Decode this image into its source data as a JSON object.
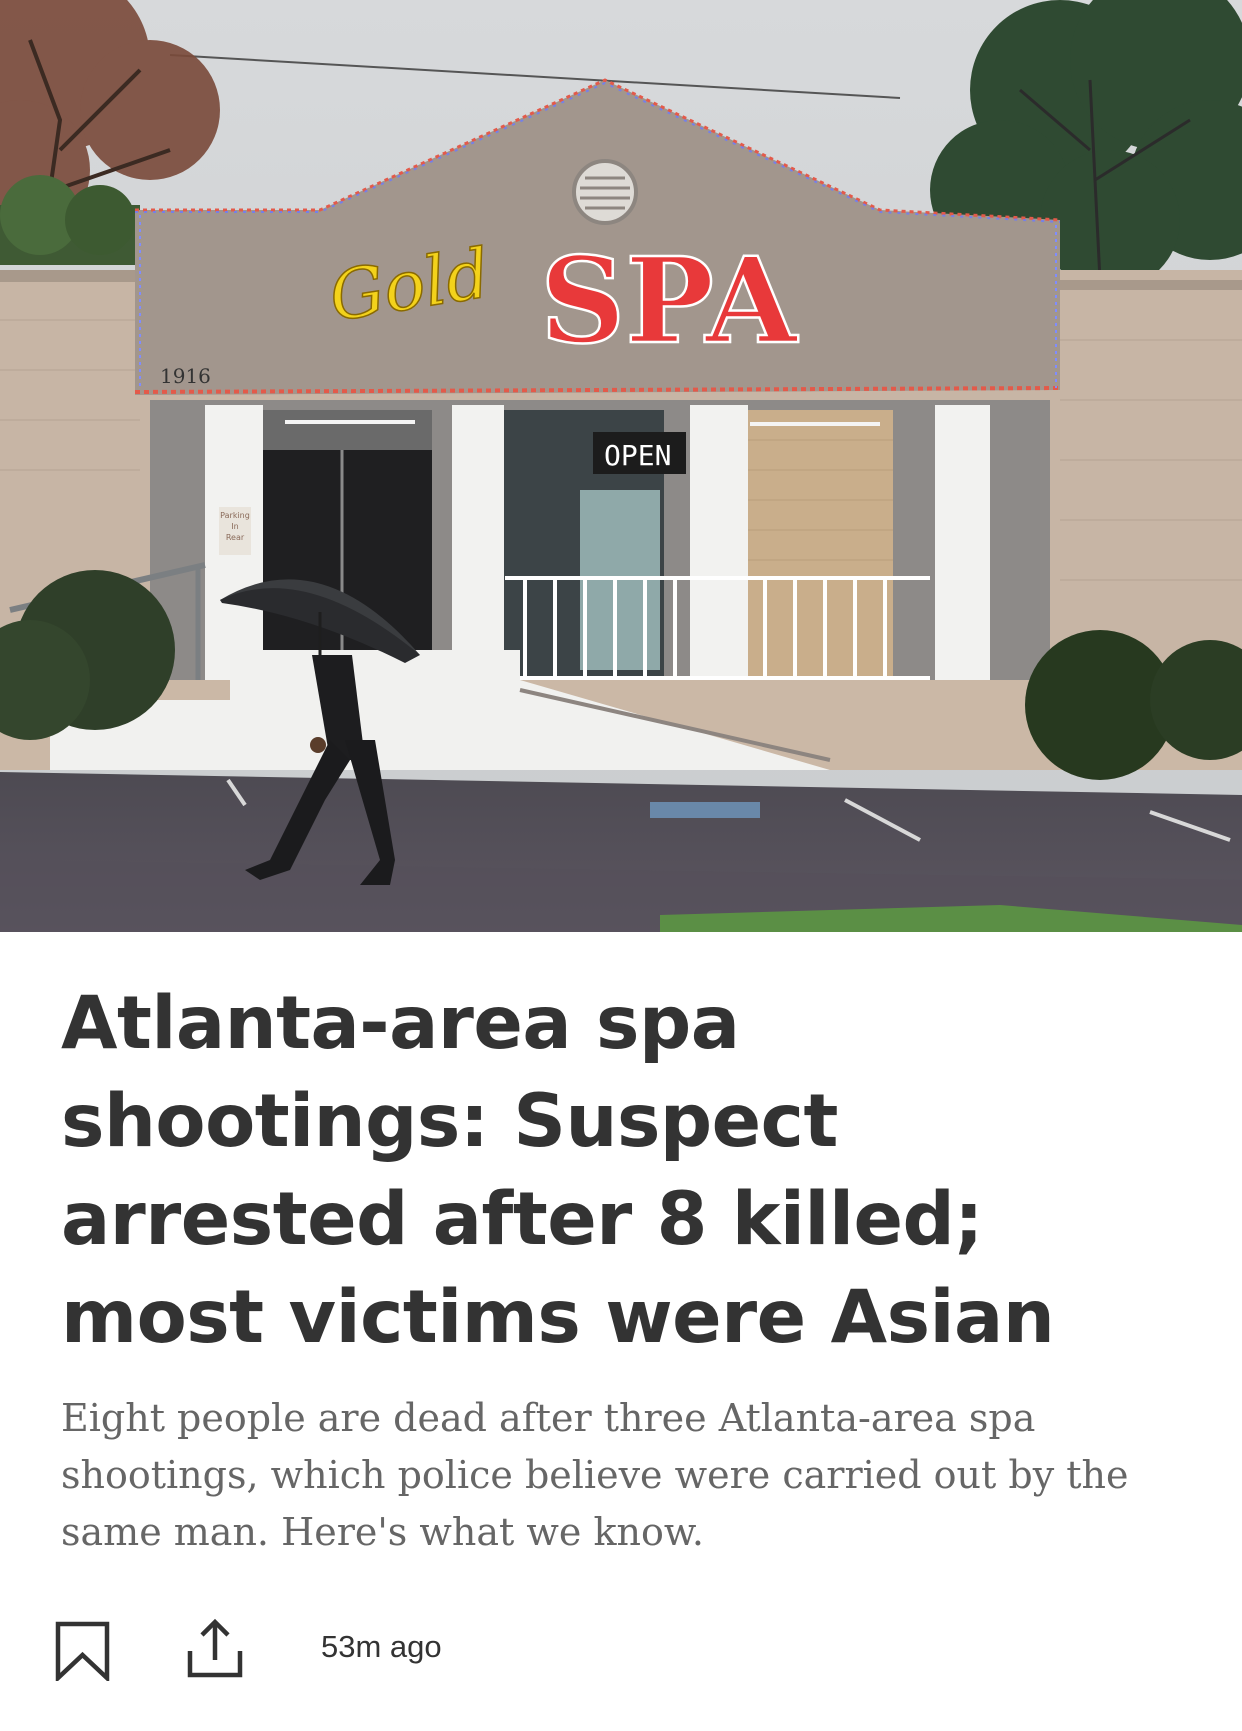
{
  "hero": {
    "icon": "photo-gold-spa-storefront",
    "sign_gold": "Gold",
    "sign_spa": "SPA",
    "address_number": "1916",
    "open_sign": "OPEN",
    "parking_sign": [
      "Parking",
      "In",
      "Rear"
    ]
  },
  "article": {
    "headline": "Atlanta-area spa shootings: Suspect arrested after 8 killed; most victims were Asian",
    "summary": "Eight people are dead after three Atlanta-area spa shootings, which police believe were carried out by the same man. Here's what we know."
  },
  "actions": {
    "bookmark_icon": "bookmark-icon",
    "share_icon": "share-icon",
    "timestamp": "53m ago"
  },
  "colors": {
    "headline": "#333333",
    "summary": "#666666",
    "neon_red": "#e8393a",
    "neon_gold": "#f3d21b"
  }
}
